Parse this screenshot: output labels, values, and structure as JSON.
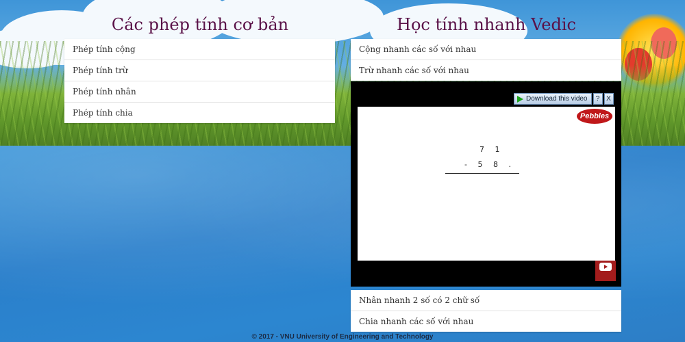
{
  "headings": {
    "left": "Các phép tính cơ bản",
    "right": "Học tính nhanh Vedic"
  },
  "basic_menu": [
    "Phép tính cộng",
    "Phép tính trừ",
    "Phép tính nhân",
    "Phép tính chia"
  ],
  "vedic_menu_top": [
    "Cộng nhanh các số với nhau",
    "Trừ nhanh các số với nhau"
  ],
  "vedic_menu_bottom": [
    "Nhân nhanh 2 số có 2 chữ số",
    "Chia nhanh các số với nhau"
  ],
  "video": {
    "download_label": "Download this video",
    "help_label": "?",
    "close_label": "X",
    "logo_text": "Pebbles",
    "math_top": "7 1",
    "math_bottom": "- 5 8 ."
  },
  "footer": "© 2017 - VNU University of Engineering and Technology"
}
